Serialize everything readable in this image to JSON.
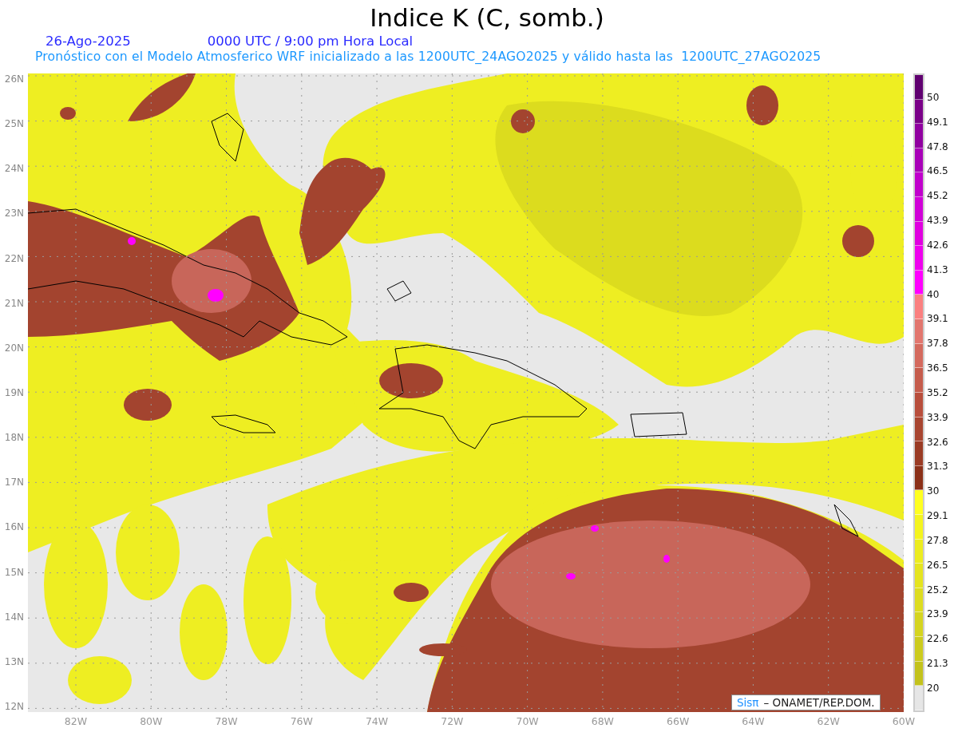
{
  "title": "Indice K (C, somb.)",
  "date": "26-Ago-2025",
  "time": "0000 UTC / 9:00 pm Hora Local",
  "subtitle": "Pronóstico con el Modelo Atmosferico WRF inicializado a las 1200UTC_24AGO2025 y válido hasta las  1200UTC_27AGO2025",
  "lat_labels": [
    "26N",
    "25N",
    "24N",
    "23N",
    "22N",
    "21N",
    "20N",
    "19N",
    "18N",
    "17N",
    "16N",
    "15N",
    "14N",
    "13N",
    "12N"
  ],
  "lon_labels": [
    "82W",
    "80W",
    "78W",
    "76W",
    "74W",
    "72W",
    "70W",
    "68W",
    "66W",
    "64W",
    "62W",
    "60W"
  ],
  "colorbar": {
    "bins": [
      {
        "color": "#600070"
      },
      {
        "color": "#7a0088"
      },
      {
        "color": "#9000a0"
      },
      {
        "color": "#a800b8"
      },
      {
        "color": "#c000cc"
      },
      {
        "color": "#d000d8"
      },
      {
        "color": "#e000e0"
      },
      {
        "color": "#ee00ee"
      },
      {
        "color": "#ff00ff"
      },
      {
        "color": "#fa8080"
      },
      {
        "color": "#e2766e"
      },
      {
        "color": "#d46a5e"
      },
      {
        "color": "#c55c4c"
      },
      {
        "color": "#b84e3c"
      },
      {
        "color": "#a84530"
      },
      {
        "color": "#9a3b24"
      },
      {
        "color": "#8b3018"
      },
      {
        "color": "#ffff20"
      },
      {
        "color": "#f4f41f"
      },
      {
        "color": "#ecec20"
      },
      {
        "color": "#e5e420"
      },
      {
        "color": "#dddc20"
      },
      {
        "color": "#d5d420"
      },
      {
        "color": "#cccb1e"
      },
      {
        "color": "#c3c21c"
      },
      {
        "color": "#e6e6e6"
      }
    ],
    "labels": [
      "50",
      "49.1",
      "47.8",
      "46.5",
      "45.2",
      "43.9",
      "42.6",
      "41.3",
      "40",
      "39.1",
      "37.8",
      "36.5",
      "35.2",
      "33.9",
      "32.6",
      "31.3",
      "30",
      "29.1",
      "27.8",
      "26.5",
      "25.2",
      "23.9",
      "22.6",
      "21.3",
      "20"
    ]
  },
  "credit": {
    "logo": "Sisπ",
    "text": "– ONAMET/REP.DOM."
  }
}
